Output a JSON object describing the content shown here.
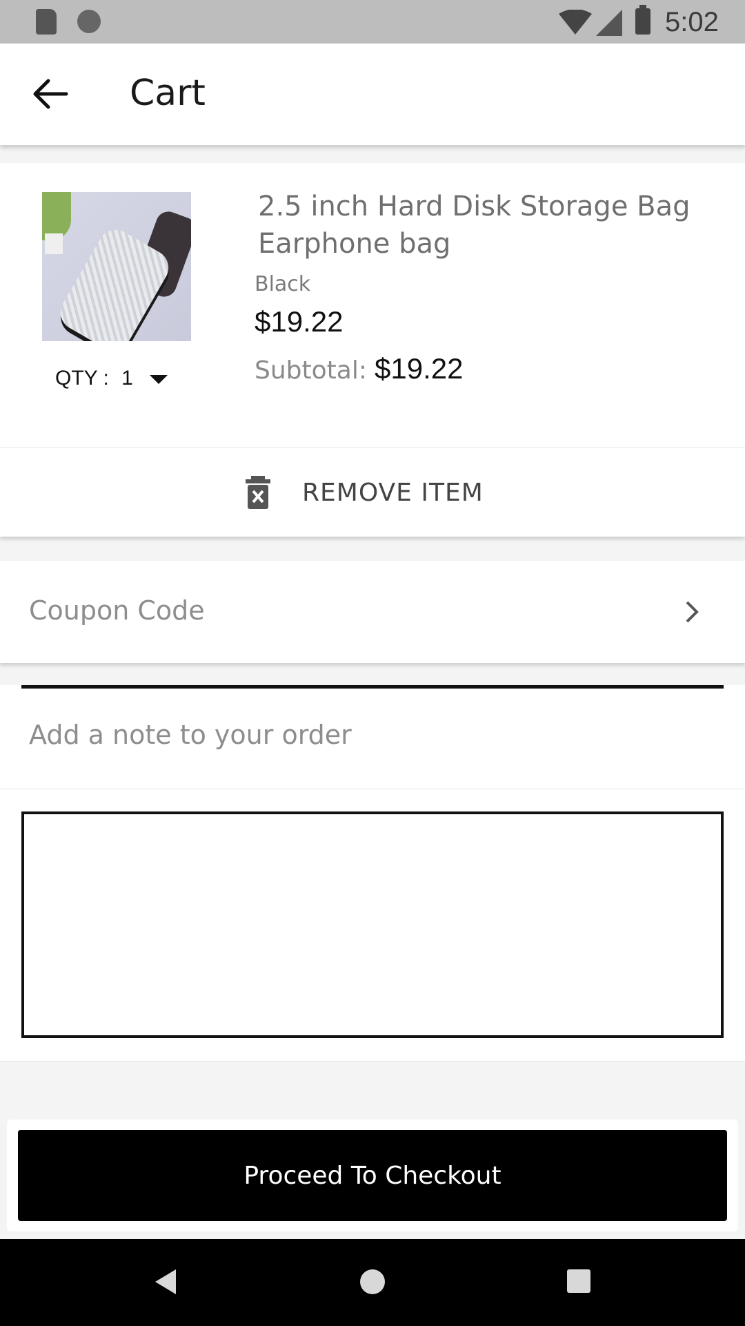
{
  "status_bar": {
    "time": "5:02"
  },
  "header": {
    "title": "Cart"
  },
  "cart_item": {
    "name": "2.5 inch Hard Disk Storage Bag Earphone bag",
    "variant": "Black",
    "price": "$19.22",
    "qty_label": "QTY :",
    "qty_value": "1",
    "subtotal_label": "Subtotal:",
    "subtotal_value": "$19.22",
    "remove_label": "REMOVE ITEM"
  },
  "coupon": {
    "label": "Coupon Code"
  },
  "note": {
    "label": "Add a note to your order",
    "value": ""
  },
  "checkout": {
    "label": "Proceed To Checkout"
  },
  "colors": {
    "primary": "#000000",
    "muted_text": "#8d8d8d",
    "background": "#f4f4f4"
  }
}
